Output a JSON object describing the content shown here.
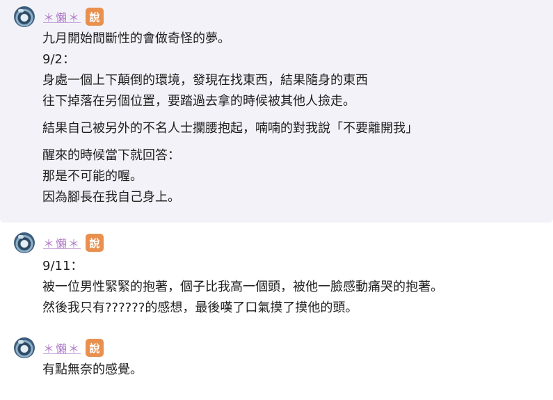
{
  "messages": [
    {
      "author": "＊懶＊",
      "badge": "說",
      "lines": [
        "九月開始間斷性的會做奇怪的夢。",
        "9/2：",
        "身處一個上下顛倒的環境，發現在找東西，結果隨身的東西",
        "往下掉落在另個位置，要踏過去拿的時候被其他人撿走。",
        "結果自己被另外的不名人士攔腰抱起，喃喃的對我說「不要離開我」",
        "醒來的時候當下就回答：",
        "那是不可能的喔。",
        "因為腳長在我自己身上。"
      ]
    },
    {
      "author": "＊懶＊",
      "badge": "說",
      "lines": [
        "9/11：",
        "被一位男性緊緊的抱著，個子比我高一個頭，被他一臉感動痛哭的抱著。",
        "然後我只有??????的感想，最後嘆了口氣摸了摸他的頭。"
      ]
    },
    {
      "author": "＊懶＊",
      "badge": "說",
      "lines": [
        "有點無奈的感覺。"
      ]
    }
  ]
}
